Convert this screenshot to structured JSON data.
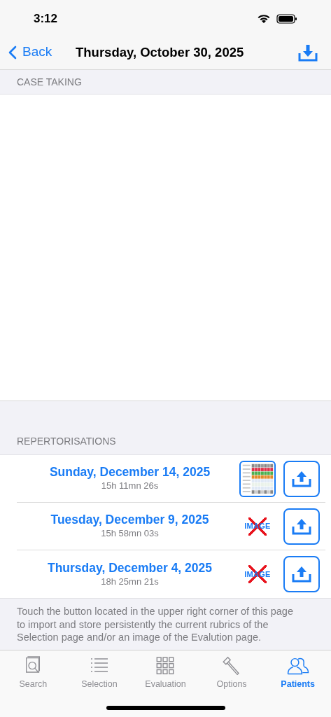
{
  "status_bar": {
    "time": "3:12"
  },
  "nav": {
    "back": "Back",
    "title": "Thursday, October 30, 2025"
  },
  "case_taking": {
    "header": "CASE TAKING"
  },
  "repertorisations": {
    "header": "REPERTORISATIONS",
    "rows": [
      {
        "date": "Sunday, December 14, 2025",
        "duration": "15h 11mn 26s",
        "kind": "image"
      },
      {
        "date": "Tuesday, December 9, 2025",
        "duration": "15h 58mn 03s",
        "kind": "no_image",
        "image_label": "IMAGE"
      },
      {
        "date": "Thursday, December 4, 2025",
        "duration": "18h 25mn 21s",
        "kind": "no_image",
        "image_label": "IMAGE"
      }
    ]
  },
  "footer_note": "Touch the button located in the upper right corner of this page to import and store persistently the current rubrics of the Selection page and/or an image of the Evalution page.",
  "tab_bar": [
    {
      "label": "Search",
      "kind": "search",
      "selected": false
    },
    {
      "label": "Selection",
      "kind": "list",
      "selected": false
    },
    {
      "label": "Evaluation",
      "kind": "grid",
      "selected": false
    },
    {
      "label": "Options",
      "kind": "hammer",
      "selected": false
    },
    {
      "label": "Patients",
      "kind": "people",
      "selected": true
    }
  ]
}
